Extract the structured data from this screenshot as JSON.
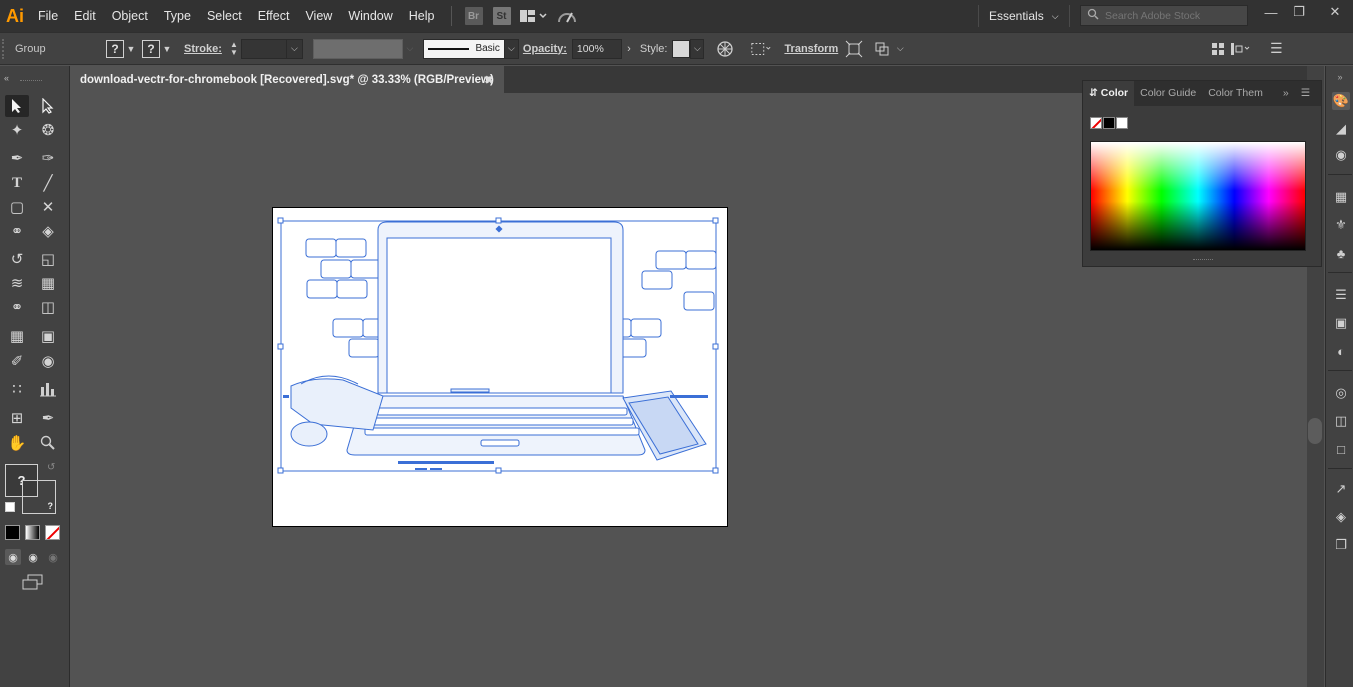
{
  "app": {
    "logo": "Ai"
  },
  "menu": [
    "File",
    "Edit",
    "Object",
    "Type",
    "Select",
    "Effect",
    "View",
    "Window",
    "Help"
  ],
  "menubar_icons": {
    "bridge": "Br",
    "stock": "St"
  },
  "workspace": {
    "label": "Essentials"
  },
  "search": {
    "placeholder": "Search Adobe Stock"
  },
  "control": {
    "selection": "Group",
    "unknown_fill": "?",
    "unknown_stroke": "?",
    "stroke_label": "Stroke:",
    "brush_label": "Basic",
    "opacity_label": "Opacity:",
    "opacity_value": "100%",
    "style_label": "Style:",
    "transform_label": "Transform"
  },
  "document": {
    "tab_title": "download-vectr-for-chromebook [Recovered].svg* @ 33.33% (RGB/Preview)"
  },
  "color_panel": {
    "tabs": [
      "Color",
      "Color Guide",
      "Color Them"
    ]
  },
  "toolbar": {
    "fill_unknown": "?",
    "stroke_unknown": "?"
  },
  "icons": {
    "selection": "selection-arrow-icon",
    "direct": "direct-selection-icon",
    "close": "close-icon"
  },
  "colors": {
    "accent": "#ff9a00",
    "selection_blue": "#3b6fd6",
    "artwork_fill": "#e9f0fb"
  }
}
